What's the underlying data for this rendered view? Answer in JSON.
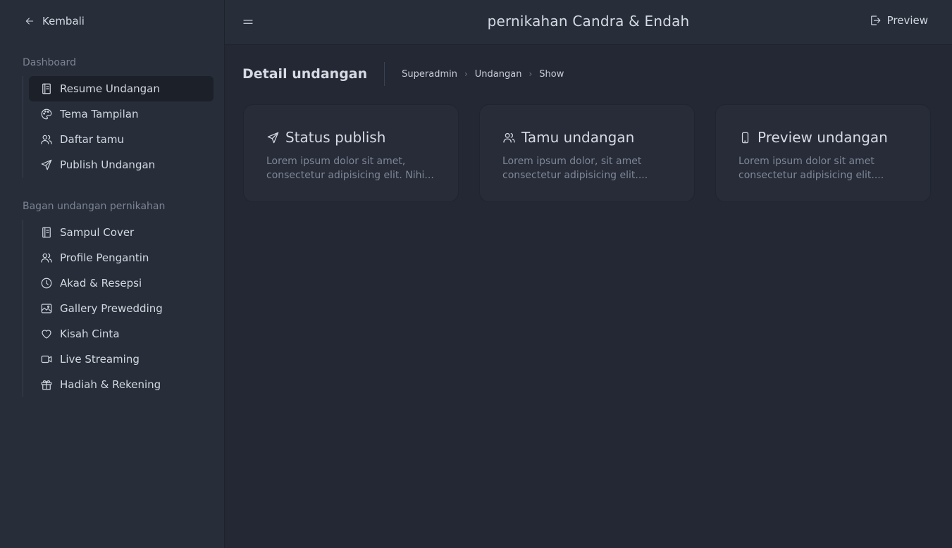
{
  "sidebar": {
    "back_label": "Kembali",
    "sections": [
      {
        "title": "Dashboard",
        "items": [
          {
            "label": "Resume Undangan",
            "icon": "notebook-icon",
            "active": true
          },
          {
            "label": "Tema Tampilan",
            "icon": "palette-icon"
          },
          {
            "label": "Daftar tamu",
            "icon": "users-icon"
          },
          {
            "label": "Publish Undangan",
            "icon": "send-icon"
          }
        ]
      },
      {
        "title": "Bagan undangan pernikahan",
        "items": [
          {
            "label": "Sampul Cover",
            "icon": "notebook-icon"
          },
          {
            "label": "Profile Pengantin",
            "icon": "users-icon"
          },
          {
            "label": "Akad & Resepsi",
            "icon": "clock-icon"
          },
          {
            "label": "Gallery Prewedding",
            "icon": "image-icon"
          },
          {
            "label": "Kisah Cinta",
            "icon": "heart-icon"
          },
          {
            "label": "Live Streaming",
            "icon": "video-icon"
          },
          {
            "label": "Hadiah & Rekening",
            "icon": "gift-icon"
          }
        ]
      }
    ]
  },
  "header": {
    "title": "pernikahan Candra & Endah",
    "preview_label": "Preview"
  },
  "page": {
    "title": "Detail undangan",
    "breadcrumb": [
      "Superadmin",
      "Undangan",
      "Show"
    ]
  },
  "cards": [
    {
      "title": "Status publish",
      "icon": "send-icon",
      "desc_line1": "Lorem ipsum dolor sit amet,",
      "desc_line2": "consectetur adipisicing elit. Nihi..."
    },
    {
      "title": "Tamu undangan",
      "icon": "users-icon",
      "desc_line1": "Lorem ipsum dolor, sit amet",
      "desc_line2": "consectetur adipisicing elit...."
    },
    {
      "title": "Preview undangan",
      "icon": "phone-icon",
      "desc_line1": "Lorem ipsum dolor sit amet",
      "desc_line2": "consectetur adipisicing elit...."
    }
  ],
  "colors": {
    "background": "#242834",
    "sidebar": "#272d39",
    "active_item": "#1c2029",
    "muted_text": "#7c8494"
  }
}
